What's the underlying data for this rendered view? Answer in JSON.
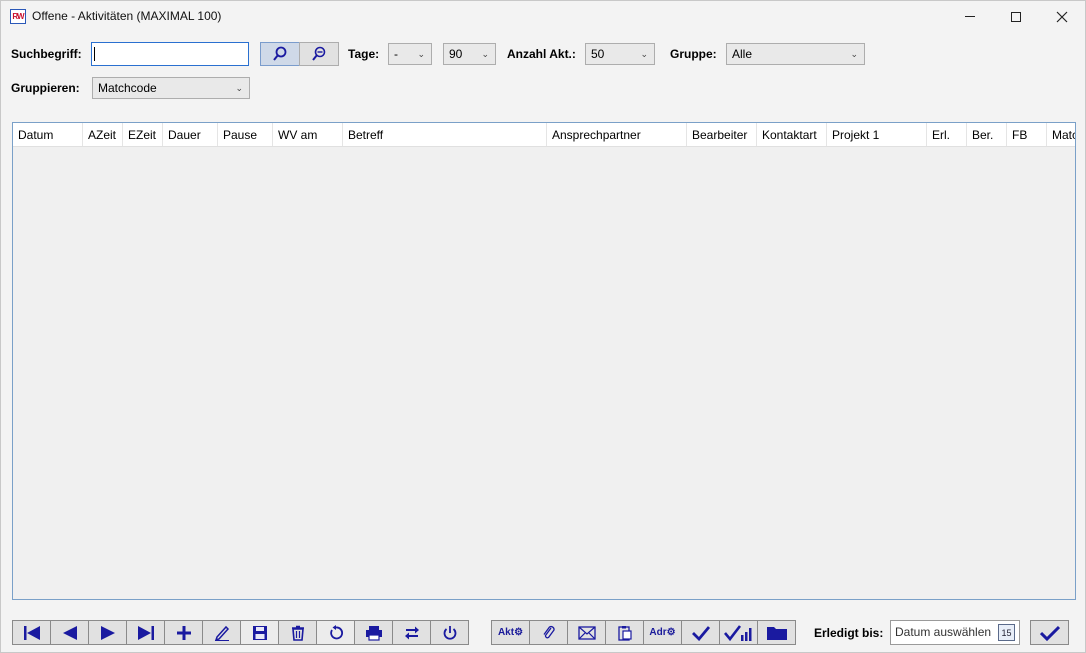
{
  "window": {
    "title": "Offene - Aktivitäten (MAXIMAL 100)",
    "app_icon_text": "RW"
  },
  "filters": {
    "search_label": "Suchbegriff:",
    "search_value": "",
    "tage_label": "Tage:",
    "tage_from": "-",
    "tage_to": "90",
    "anzahl_label": "Anzahl Akt.:",
    "anzahl_value": "50",
    "gruppe_label": "Gruppe:",
    "gruppe_value": "Alle",
    "gruppieren_label": "Gruppieren:",
    "gruppieren_value": "Matchcode"
  },
  "grid": {
    "columns": [
      "Datum",
      "AZeit",
      "EZeit",
      "Dauer",
      "Pause",
      "WV am",
      "Betreff",
      "Ansprechpartner",
      "Bearbeiter",
      "Kontaktart",
      "Projekt 1",
      "Erl.",
      "Ber.",
      "FB",
      "Matc"
    ],
    "rows": []
  },
  "toolbar": {
    "akt_label": "Akt",
    "adr_label": "Adr",
    "erledigt_label": "Erledigt bis:",
    "date_placeholder": "Datum auswählen",
    "calendar_day": "15"
  },
  "colors": {
    "accent": "#1a1aa0",
    "grid_border": "#7aa0c8"
  }
}
